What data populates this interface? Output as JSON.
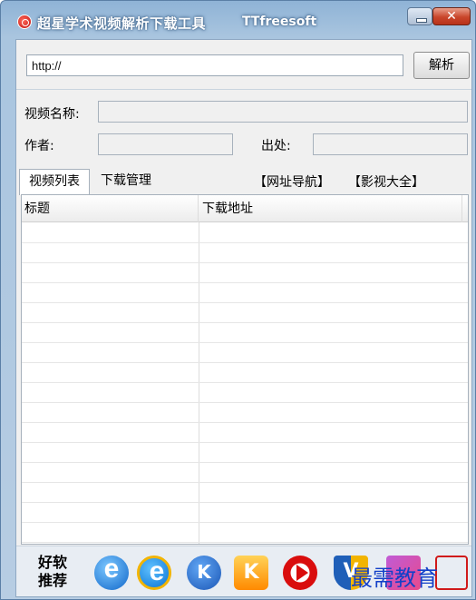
{
  "window": {
    "title": "超星学术视频解析下载工具",
    "brand": "TTfreesoft",
    "close_glyph": "✕"
  },
  "url_bar": {
    "value": "http://",
    "parse_label": "解析"
  },
  "info": {
    "name_label": "视频名称:",
    "name_value": "",
    "author_label": "作者:",
    "author_value": "",
    "source_label": "出处:",
    "source_value": ""
  },
  "tabs": [
    {
      "label": "视频列表",
      "active": true
    },
    {
      "label": "下载管理",
      "active": false
    }
  ],
  "links": [
    "【网址导航】",
    "【影视大全】"
  ],
  "table": {
    "columns": [
      "标题",
      "下载地址"
    ],
    "rows": []
  },
  "footer": {
    "label_line1": "好软",
    "label_line2": "推荐",
    "apps": [
      {
        "icon": "ie-blue-icon"
      },
      {
        "icon": "ie-gold-ring-icon"
      },
      {
        "icon": "k-blue-icon"
      },
      {
        "icon": "k-gift-icon"
      },
      {
        "icon": "red-play-icon"
      },
      {
        "icon": "v-shield-icon"
      },
      {
        "icon": "purple-box-icon"
      },
      {
        "icon": "red-app-icon"
      }
    ]
  },
  "watermark": "最需教育"
}
